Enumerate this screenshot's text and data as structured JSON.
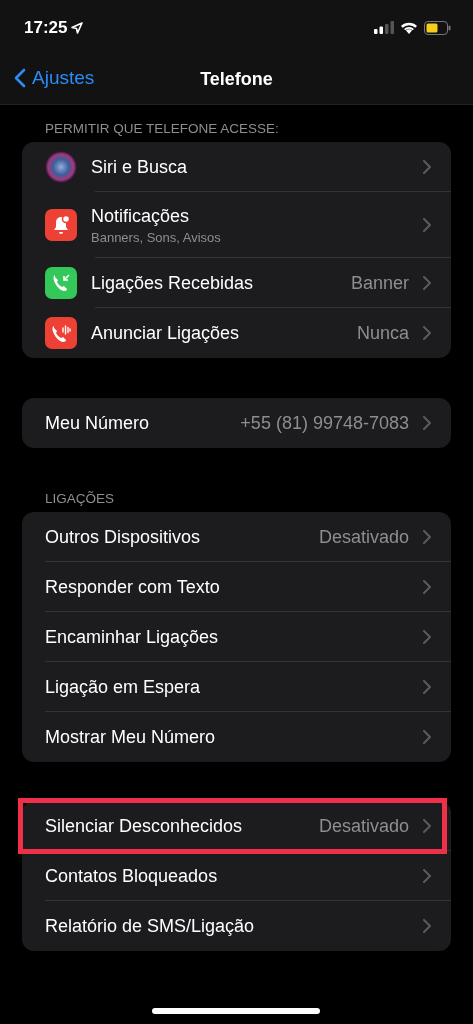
{
  "status_bar": {
    "time": "17:25"
  },
  "nav": {
    "back": "Ajustes",
    "title": "Telefone"
  },
  "sections": [
    {
      "header": "PERMITIR QUE TELEFONE ACESSE:",
      "rows": [
        {
          "kind": "siri",
          "label": "Siri e Busca",
          "highlighted": false
        },
        {
          "kind": "bell",
          "label": "Notificações",
          "subtitle": "Banners, Sons, Avisos",
          "highlighted": false
        },
        {
          "kind": "phone-in",
          "label": "Ligações Recebidas",
          "value": "Banner",
          "highlighted": false
        },
        {
          "kind": "phone-announce",
          "label": "Anunciar Ligações",
          "value": "Nunca",
          "highlighted": false
        }
      ]
    },
    {
      "rows": [
        {
          "label": "Meu Número",
          "value": "+55 (81) 99748-7083",
          "highlighted": false
        }
      ]
    },
    {
      "header": "LIGAÇÕES",
      "rows": [
        {
          "label": "Outros Dispositivos",
          "value": "Desativado",
          "highlighted": false
        },
        {
          "label": "Responder com Texto",
          "highlighted": false
        },
        {
          "label": "Encaminhar Ligações",
          "highlighted": false
        },
        {
          "label": "Ligação em Espera",
          "highlighted": false
        },
        {
          "label": "Mostrar Meu Número",
          "highlighted": false
        }
      ]
    },
    {
      "rows": [
        {
          "label": "Silenciar Desconhecidos",
          "value": "Desativado",
          "highlighted": true
        },
        {
          "label": "Contatos Bloqueados",
          "highlighted": false
        },
        {
          "label": "Relatório de SMS/Ligação",
          "highlighted": false
        }
      ]
    }
  ]
}
